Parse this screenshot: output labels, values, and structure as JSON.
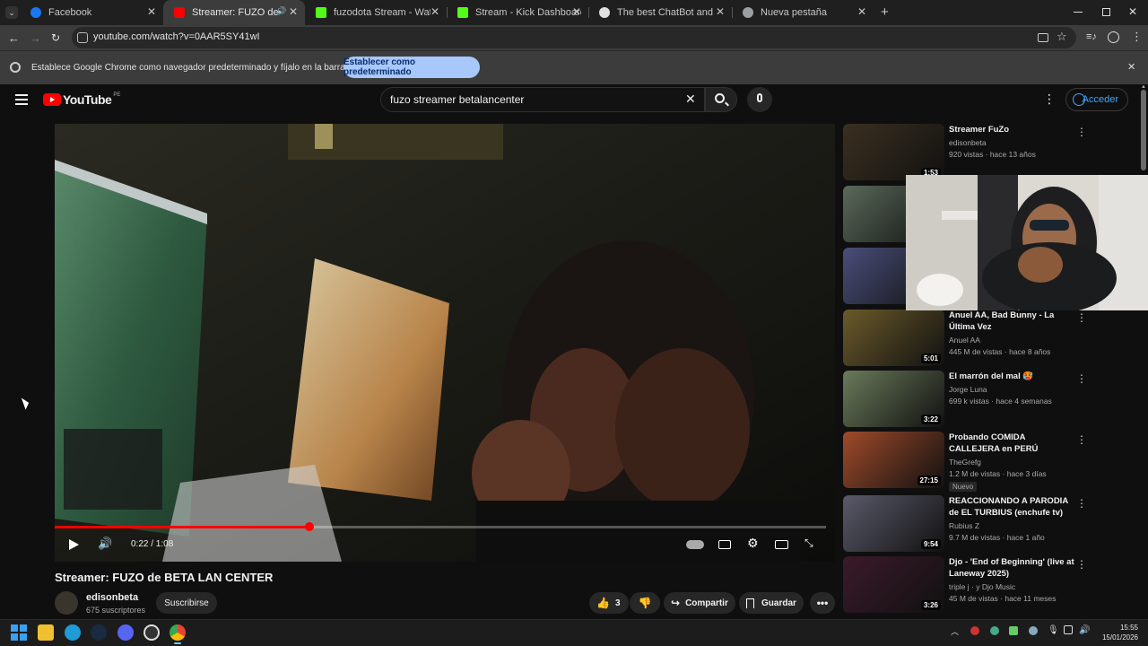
{
  "browser": {
    "tabs": [
      {
        "title": "Facebook",
        "color": "#1877f2"
      },
      {
        "title": "Streamer: FUZO de BETA LA",
        "color": "#ff0000",
        "active": true
      },
      {
        "title": "fuzodota Stream - Watch Live o",
        "color": "#53fc18"
      },
      {
        "title": "Stream - Kick Dashboard",
        "color": "#53fc18"
      },
      {
        "title": "The best ChatBot and Widgets",
        "color": "#e0e0e0"
      },
      {
        "title": "Nueva pestaña",
        "color": "#9aa0a6"
      }
    ],
    "new_tab": "+",
    "url": "youtube.com/watch?v=0AAR5SY41wI",
    "infobar_text": "Establece Google Chrome como navegador predeterminado y fíjalo en la barra de tareas",
    "infobar_button": "Establecer como predeterminado"
  },
  "youtube": {
    "logo_text": "YouTube",
    "region": "PE",
    "search_query": "fuzo streamer betalancenter",
    "signin_label": "Acceder"
  },
  "player": {
    "time": "0:22 / 1:08",
    "progress_fraction": 0.33
  },
  "video": {
    "title": "Streamer: FUZO de BETA LAN CENTER",
    "channel": "edisonbeta",
    "subscribers": "675 suscriptores",
    "subscribe_label": "Suscribirse",
    "likes": "3",
    "share_label": "Compartir",
    "save_label": "Guardar"
  },
  "recommendations": [
    {
      "title": "Streamer FuZo",
      "channel": "edisonbeta",
      "meta": "920 vistas · hace 13 años",
      "duration": "1:53",
      "thumb": "#3b3020"
    },
    {
      "title": "",
      "channel": "",
      "meta": "",
      "duration": "",
      "thumb": "#5a6a5a"
    },
    {
      "title": "",
      "channel": "",
      "meta": "",
      "duration": "",
      "thumb": "#4a4e7a"
    },
    {
      "title": "Anuel AA, Bad Bunny - La Última Vez",
      "channel": "Anuel AA",
      "meta": "445 M de vistas · hace 8 años",
      "duration": "5:01",
      "thumb": "#6b5a2a"
    },
    {
      "title": "El marrón del mal 🥵",
      "channel": "Jorge Luna",
      "meta": "699 k vistas · hace 4 semanas",
      "duration": "3:22",
      "thumb": "#6a7a5a"
    },
    {
      "title": "Probando COMIDA CALLEJERA en PERÚ",
      "channel": "TheGrefg",
      "meta": "1.2 M de vistas · hace 3 días",
      "duration": "27:15",
      "badge": "Nuevo",
      "thumb": "#a04a2a"
    },
    {
      "title": "REACCIONANDO A PARODIA de EL TURBIUS (enchufe tv)",
      "channel": "Rubius Z",
      "meta": "9.7 M de vistas · hace 1 año",
      "duration": "9:54",
      "thumb": "#5a5a6a"
    },
    {
      "title": "Djo - 'End of Beginning' (live at Laneway 2025)",
      "channel": "triple j · y Djo Music",
      "meta": "45 M de vistas · hace 11 meses",
      "duration": "3:26",
      "thumb": "#3a1a2a"
    }
  ],
  "taskbar": {
    "time": "15:55",
    "date": "15/01/2026"
  }
}
